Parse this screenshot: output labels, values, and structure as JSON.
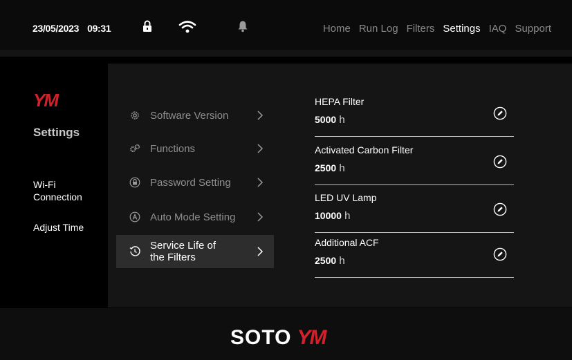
{
  "status": {
    "date": "23/05/2023",
    "time": "09:31"
  },
  "nav": {
    "items": [
      "Home",
      "Run Log",
      "Filters",
      "Settings",
      "IAQ",
      "Support"
    ],
    "active": "Settings"
  },
  "left": {
    "logo": "YM",
    "title": "Settings",
    "items": [
      "Wi-Fi Connection",
      "Adjust Time"
    ]
  },
  "menu": {
    "items": [
      {
        "label": "Software Version",
        "icon": "gear-icon"
      },
      {
        "label": "Functions",
        "icon": "gears-icon"
      },
      {
        "label": "Password Setting",
        "icon": "lock-circle-icon"
      },
      {
        "label": "Auto Mode Setting",
        "icon": "auto-a-icon"
      },
      {
        "label": "Service Life of the Filters",
        "icon": "history-clock-icon"
      }
    ],
    "active": "Service Life of the Filters"
  },
  "filters": [
    {
      "name": "HEPA Filter",
      "value": "5000",
      "unit": "h"
    },
    {
      "name": "Activated Carbon Filter",
      "value": "2500",
      "unit": "h"
    },
    {
      "name": "LED UV Lamp",
      "value": "10000",
      "unit": "h"
    },
    {
      "name": "Additional ACF",
      "value": "2500",
      "unit": "h"
    }
  ],
  "footer": {
    "brand1": "SOTO",
    "brand2": "YM"
  },
  "colors": {
    "accent": "#d4202b",
    "background": "#000000",
    "panel": "#151515",
    "selected": "#2d2d2d"
  }
}
